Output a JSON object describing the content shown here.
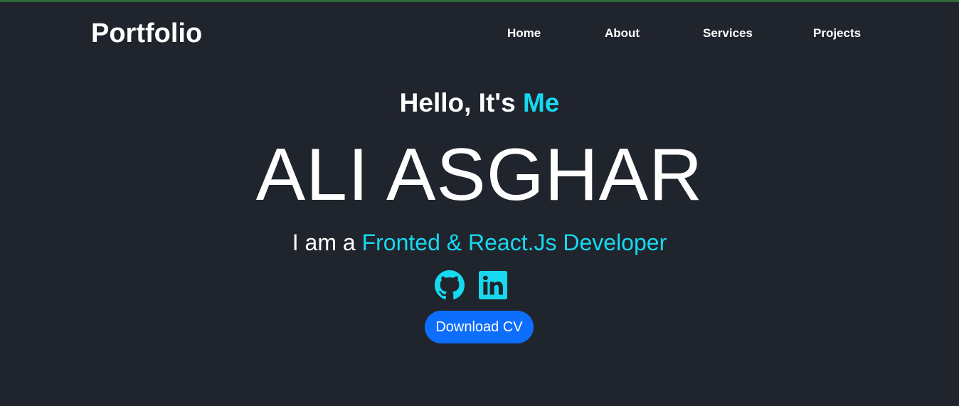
{
  "brand": {
    "label": "Portfolio"
  },
  "nav": {
    "items": [
      {
        "label": "Home"
      },
      {
        "label": "About"
      },
      {
        "label": "Services"
      },
      {
        "label": "Projects"
      }
    ]
  },
  "hero": {
    "greeting_prefix": "Hello, It's",
    "greeting_highlight": "Me",
    "name": "ALI ASGHAR",
    "role_prefix": "I am a",
    "role_highlight": "Fronted & React.Js Developer",
    "download_label": "Download CV"
  },
  "socials": [
    {
      "icon": "github-icon"
    },
    {
      "icon": "linkedin-icon"
    }
  ],
  "colors": {
    "background": "#20242d",
    "accent": "#16d9f0",
    "button": "#0d6efd",
    "text": "#ffffff"
  }
}
